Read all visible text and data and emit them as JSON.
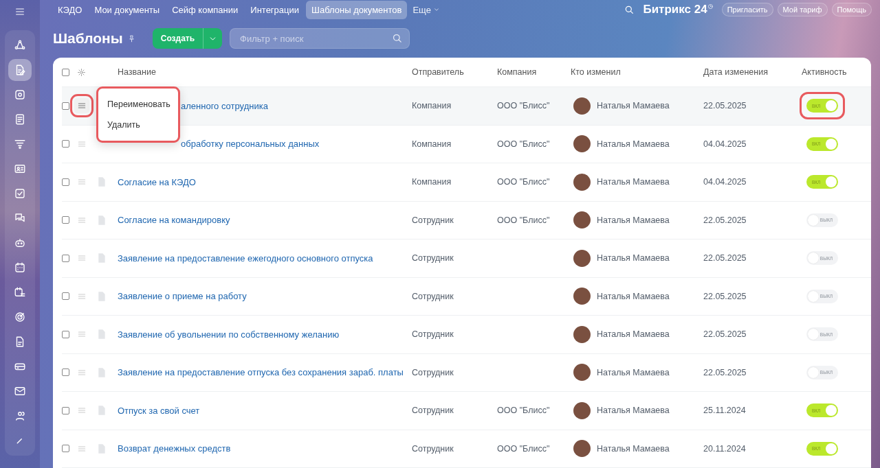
{
  "sidebar": {
    "items": [
      {
        "selected": false
      },
      {
        "selected": true
      },
      {
        "selected": false
      },
      {
        "selected": false
      },
      {
        "selected": false
      },
      {
        "selected": false
      },
      {
        "selected": false
      },
      {
        "selected": false
      },
      {
        "selected": false
      },
      {
        "selected": false
      },
      {
        "selected": false
      },
      {
        "selected": false
      },
      {
        "selected": false
      },
      {
        "selected": false
      },
      {
        "selected": false
      },
      {
        "selected": false
      },
      {
        "selected": false
      }
    ]
  },
  "top_nav": {
    "tabs": [
      {
        "label": "КЭДО",
        "selected": false
      },
      {
        "label": "Мои документы",
        "selected": false
      },
      {
        "label": "Сейф компании",
        "selected": false
      },
      {
        "label": "Интеграции",
        "selected": false
      },
      {
        "label": "Шаблоны документов",
        "selected": true
      }
    ],
    "more": "Еще",
    "logo": "Битрикс 24",
    "buttons": [
      "Пригласить",
      "Мой тариф",
      "Помощь"
    ]
  },
  "header": {
    "title": "Шаблоны",
    "create_button": "Создать",
    "filter": {
      "placeholder": "Фильтр + поиск"
    }
  },
  "table": {
    "select_all_checked": false,
    "columns": [
      "Название",
      "Отправитель",
      "Компания",
      "Кто изменил",
      "Дата изменения",
      "Активность"
    ],
    "rows": [
      {
        "name": "аленного сотрудника",
        "cut_off": true,
        "hovered": true,
        "checked": false,
        "sender": "Компания",
        "company": "ООО \"Блисс\"",
        "modified_by": "Наталья Мамаева",
        "date": "22.05.2025",
        "active": true,
        "toggle_label": "ВКЛ",
        "toggle_highlighted": true,
        "handle_highlighted": true
      },
      {
        "name": "обработку персональных данных",
        "cut_off": true,
        "hovered": false,
        "checked": false,
        "sender": "Компания",
        "company": "ООО \"Блисс\"",
        "modified_by": "Наталья Мамаева",
        "date": "04.04.2025",
        "active": true,
        "toggle_label": "ВКЛ",
        "toggle_highlighted": false,
        "handle_highlighted": false
      },
      {
        "name": "Согласие на КЭДО",
        "cut_off": false,
        "hovered": false,
        "checked": false,
        "sender": "Компания",
        "company": "ООО \"Блисс\"",
        "modified_by": "Наталья Мамаева",
        "date": "04.04.2025",
        "active": true,
        "toggle_label": "ВКЛ",
        "toggle_highlighted": false,
        "handle_highlighted": false
      },
      {
        "name": "Согласие на командировку",
        "cut_off": false,
        "hovered": false,
        "checked": false,
        "sender": "Сотрудник",
        "company": "ООО \"Блисс\"",
        "modified_by": "Наталья Мамаева",
        "date": "22.05.2025",
        "active": false,
        "toggle_label": "ВЫКЛ",
        "toggle_highlighted": false,
        "handle_highlighted": false
      },
      {
        "name": "Заявление на предоставление ежегодного основного отпуска",
        "cut_off": false,
        "hovered": false,
        "checked": false,
        "sender": "Сотрудник",
        "modified_by": "Наталья Мамаева",
        "date": "22.05.2025",
        "active": false,
        "toggle_label": "ВЫКЛ",
        "toggle_highlighted": false,
        "handle_highlighted": false
      },
      {
        "name": "Заявление о приеме на работу",
        "cut_off": false,
        "hovered": false,
        "checked": false,
        "sender": "Сотрудник",
        "modified_by": "Наталья Мамаева",
        "date": "22.05.2025",
        "active": false,
        "toggle_label": "ВЫКЛ",
        "toggle_highlighted": false,
        "handle_highlighted": false
      },
      {
        "name": "Заявление об увольнении по собственному желанию",
        "cut_off": false,
        "hovered": false,
        "checked": false,
        "sender": "Сотрудник",
        "modified_by": "Наталья Мамаева",
        "date": "22.05.2025",
        "active": false,
        "toggle_label": "ВЫКЛ",
        "toggle_highlighted": false,
        "handle_highlighted": false
      },
      {
        "name": "Заявление на предоставление отпуска без сохранения зараб. платы",
        "cut_off": false,
        "hovered": false,
        "checked": false,
        "sender": "Сотрудник",
        "modified_by": "Наталья Мамаева",
        "date": "22.05.2025",
        "active": false,
        "toggle_label": "ВЫКЛ",
        "toggle_highlighted": false,
        "handle_highlighted": false
      },
      {
        "name": "Отпуск за свой счет",
        "cut_off": false,
        "hovered": false,
        "checked": false,
        "sender": "Сотрудник",
        "company": "ООО \"Блисс\"",
        "modified_by": "Наталья Мамаева",
        "date": "25.11.2024",
        "active": true,
        "toggle_label": "ВКЛ",
        "toggle_highlighted": false,
        "handle_highlighted": false
      },
      {
        "name": "Возврат денежных средств",
        "cut_off": false,
        "hovered": false,
        "checked": false,
        "sender": "Сотрудник",
        "company": "ООО \"Блисс\"",
        "modified_by": "Наталья Мамаева",
        "date": "20.11.2024",
        "active": true,
        "toggle_label": "ВКЛ",
        "toggle_highlighted": false,
        "handle_highlighted": false
      }
    ]
  },
  "context_menu": {
    "items": [
      "Переименовать",
      "Удалить"
    ],
    "highlighted": true
  }
}
